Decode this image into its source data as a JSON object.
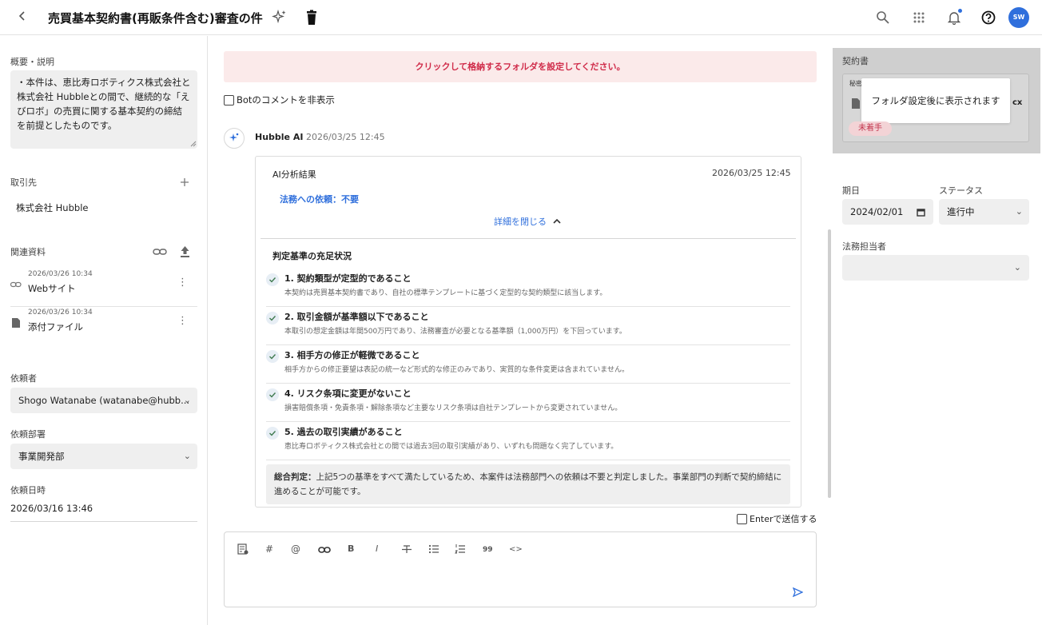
{
  "header": {
    "back_icon": "chevron-left-icon",
    "title": "売買基本契約書(再販条件含む)審査の件",
    "ai_icon": "sparkle-icon",
    "trash_icon": "trash-icon",
    "search_icon": "search-icon",
    "apps_icon": "grid-icon",
    "bell_icon": "bell-icon",
    "help_icon": "help-icon",
    "avatar_initials": "SW",
    "avatar_color": "#2f6fdc"
  },
  "left": {
    "summary_label": "概要・説明",
    "summary_text": "・本件は、恵比寿ロボティクス株式会社と株式会社 Hubbleとの間で、継続的な「えびロボ」の売買に関する基本契約の締結を前提としたものです。",
    "counterparty_label": "取引先",
    "counterparty_value": "株式会社 Hubble",
    "related_label": "関連資料",
    "docs": [
      {
        "timestamp": "2026/03/26 10:34",
        "name": "Webサイト",
        "icon": "link-icon"
      },
      {
        "timestamp": "2026/03/26 10:34",
        "name": "添付ファイル",
        "icon": "file-icon"
      }
    ],
    "requester_label": "依頼者",
    "requester_value": "Shogo Watanabe (watanabe@hubb...",
    "department_label": "依頼部署",
    "department_value": "事業開発部",
    "request_date_label": "依頼日時",
    "request_date_value": "2026/03/16 13:46"
  },
  "center": {
    "banner_text": "クリックして格納するフォルダを設定してください。",
    "banner_color": "#d02c4a",
    "hide_bot_label": "Botのコメントを非表示",
    "author": "Hubble AI",
    "post_time": "2026/03/25 12:45",
    "card": {
      "title": "AI分析結果",
      "time": "2026/03/25 12:45",
      "legal_request": "法務への依頼：不要",
      "toggle_label": "詳細を閉じる",
      "criteria_heading": "判定基準の充足状況",
      "criteria": [
        {
          "title": "1. 契約類型が定型的であること",
          "desc": "本契約は売買基本契約書であり、自社の標準テンプレートに基づく定型的な契約類型に該当します。"
        },
        {
          "title": "2. 取引金額が基準額以下であること",
          "desc": "本取引の想定金額は年間500万円であり、法務審査が必要となる基準額（1,000万円）を下回っています。"
        },
        {
          "title": "3. 相手方の修正が軽微であること",
          "desc": "相手方からの修正要望は表記の統一など形式的な修正のみであり、実質的な条件変更は含まれていません。"
        },
        {
          "title": "4. リスク条項に変更がないこと",
          "desc": "損害賠償条項・免責条項・解除条項など主要なリスク条項は自社テンプレートから変更されていません。"
        },
        {
          "title": "5. 過去の取引実績があること",
          "desc": "恵比寿ロボティクス株式会社との間では過去3回の取引実績があり、いずれも問題なく完了しています。"
        }
      ],
      "summary_label": "総合判定：",
      "summary_text": "上記5つの基準をすべて満たしているため、本案件は法務部門への依頼は不要と判定しました。事業部門の判断で契約締結に進めることが可能です。"
    },
    "enter_send_label": "Enterで送信する",
    "toolbar": {
      "bold": "B",
      "italic": "I",
      "quote": "99",
      "code": "<>",
      "hash": "#",
      "mention": "@"
    }
  },
  "right": {
    "contract_label": "契約書",
    "contract_prefix": "秘密",
    "contract_ext": "cx",
    "tooltip": "フォルダ設定後に表示されます",
    "status_badge": "未着手",
    "due_label": "期日",
    "due_value": "2024/02/01",
    "status_label": "ステータス",
    "status_value": "進行中",
    "legal_owner_label": "法務担当者"
  }
}
